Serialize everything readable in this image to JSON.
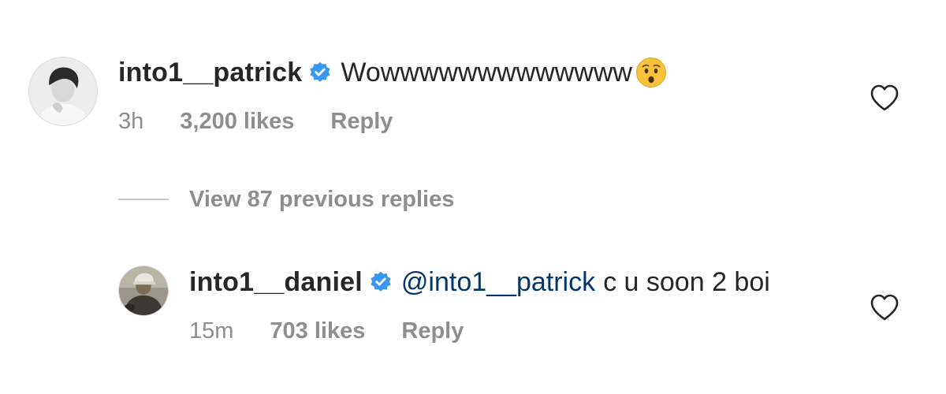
{
  "comment": {
    "username": "into1__patrick",
    "text": "Wowwwwwwwwwwwww",
    "emoji": "hushed-face-emoji",
    "time": "3h",
    "likes": "3,200 likes",
    "reply_label": "Reply"
  },
  "view_replies": {
    "label": "View 87 previous replies"
  },
  "reply": {
    "username": "into1__daniel",
    "mention": "@into1__patrick",
    "text": "c u soon 2 boi",
    "time": "15m",
    "likes": "703 likes",
    "reply_label": "Reply"
  },
  "colors": {
    "text": "#262626",
    "secondary": "#8e8e8e",
    "mention": "#00376b",
    "verified": "#3897f0"
  }
}
